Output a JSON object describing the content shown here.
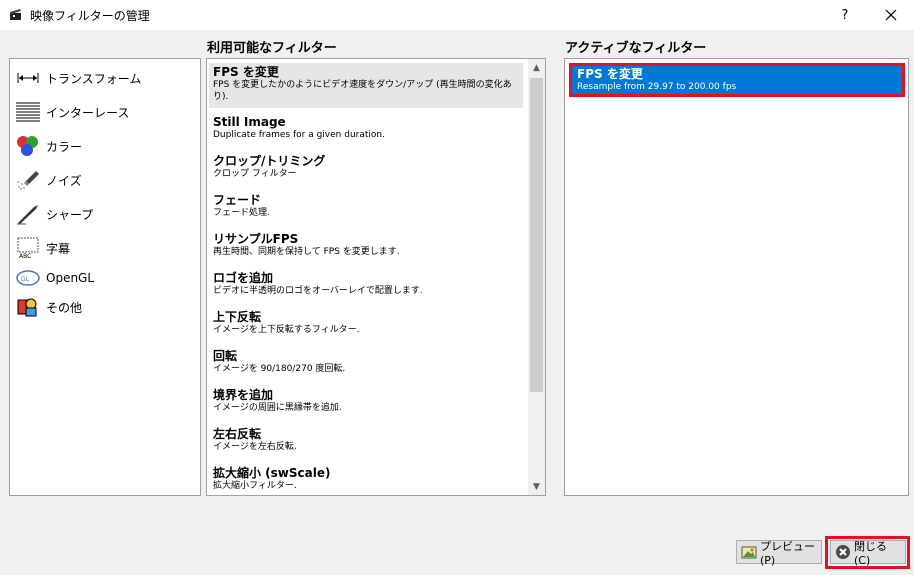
{
  "window": {
    "title": "映像フィルターの管理",
    "help_label": "?",
    "icon": "clapperboard-icon",
    "close_icon": "close-icon"
  },
  "categories": {
    "items": [
      {
        "label": "トランスフォーム",
        "icon": "transform-arrows-icon"
      },
      {
        "label": "インターレース",
        "icon": "interlace-lines-icon"
      },
      {
        "label": "カラー",
        "icon": "color-circles-icon"
      },
      {
        "label": "ノイズ",
        "icon": "noise-brush-icon"
      },
      {
        "label": "シャープ",
        "icon": "sharpen-knife-icon"
      },
      {
        "label": "字幕",
        "icon": "subtitle-abc-icon"
      },
      {
        "label": "OpenGL",
        "icon": "opengl-logo-icon"
      },
      {
        "label": "その他",
        "icon": "misc-picture-icon"
      }
    ]
  },
  "available": {
    "header": "利用可能なフィルター",
    "items": [
      {
        "name": "FPS を変更",
        "desc": "FPS を変更したかのようにビデオ速度をダウン/アップ (再生時間の変化あり)."
      },
      {
        "name": "Still Image",
        "desc": "Duplicate frames for a given duration."
      },
      {
        "name": "クロップ/トリミング",
        "desc": "クロップ フィルター"
      },
      {
        "name": "フェード",
        "desc": "フェード処理."
      },
      {
        "name": "リサンプルFPS",
        "desc": "再生時間、同期を保持して FPS を変更します."
      },
      {
        "name": "ロゴを追加",
        "desc": "ビデオに半透明のロゴをオーバーレイで配置します."
      },
      {
        "name": "上下反転",
        "desc": "イメージを上下反転するフィルター."
      },
      {
        "name": "回転",
        "desc": "イメージを 90/180/270 度回転."
      },
      {
        "name": "境界を追加",
        "desc": "イメージの周囲に黒縁帯を追加."
      },
      {
        "name": "左右反転",
        "desc": "イメージを左右反転."
      },
      {
        "name": "拡大縮小 (swScale)",
        "desc": "拡大縮小フィルター."
      }
    ]
  },
  "active": {
    "header": "アクティブなフィルター",
    "items": [
      {
        "name": "FPS を変更",
        "desc": "Resample from 29.97 to 200.00 fps"
      }
    ]
  },
  "buttons": {
    "preview_label": "プレビュー(P)",
    "close_label": "閉じる(C)"
  },
  "colors": {
    "selection": "#0078d7",
    "highlight_border": "#e81123"
  }
}
